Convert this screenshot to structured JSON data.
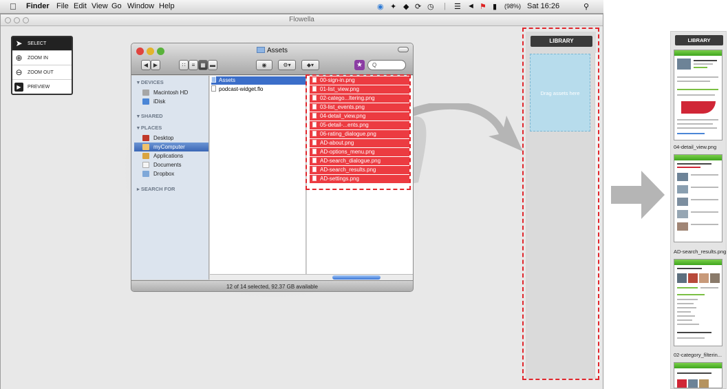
{
  "menubar": {
    "app_name": "Finder",
    "menus": [
      "File",
      "Edit",
      "View",
      "Go",
      "Window",
      "Help"
    ],
    "battery": "(98%)",
    "clock": "Sat 16:26",
    "search_icon": "search-icon"
  },
  "flowella": {
    "title": "Flowella",
    "tools": [
      {
        "label": "SELECT",
        "icon": "arrow-cursor-icon",
        "selected": true
      },
      {
        "label": "ZOOM IN",
        "icon": "zoom-in-icon",
        "selected": false
      },
      {
        "label": "ZOOM OUT",
        "icon": "zoom-out-icon",
        "selected": false
      },
      {
        "label": "PREVIEW",
        "icon": "play-icon",
        "selected": false
      }
    ],
    "library": {
      "header": "LIBRARY",
      "drop_hint": "Drag assets here"
    }
  },
  "finder": {
    "title": "Assets",
    "search_placeholder": "Q",
    "sidebar": {
      "devices_header": "DEVICES",
      "devices": [
        "Macintosh HD",
        "iDisk"
      ],
      "shared_header": "SHARED",
      "places_header": "PLACES",
      "places": [
        {
          "label": "Desktop",
          "selected": false
        },
        {
          "label": "myComputer",
          "selected": true
        },
        {
          "label": "Applications",
          "selected": false
        },
        {
          "label": "Documents",
          "selected": false
        },
        {
          "label": "Dropbox",
          "selected": false
        }
      ],
      "search_header": "SEARCH FOR"
    },
    "column1": [
      "Assets",
      "podcast-widget.flo"
    ],
    "files": [
      "00-sign-in.png",
      "01-list_view.png",
      "02-catego...ltering.png",
      "03-list_events.png",
      "04-detail_view.png",
      "05-detail-...ents.png",
      "06-rating_dialogue.png",
      "AD-about.png",
      "AD-options_menu.png",
      "AD-search_dialogue.png",
      "AD-search_results.png",
      "AD-settings.png"
    ],
    "status": "12 of 14 selected, 92.37 GB available"
  },
  "library_column": {
    "header": "LIBRARY",
    "items": [
      "04-detail_view.png",
      "AD-search_results.png",
      "02-category_filterin..."
    ]
  },
  "colors": {
    "selection_red": "#ec3b41",
    "marquee": "#e0262c",
    "drop_zone": "#b7dcec",
    "arrow_gray": "#b5b5b5",
    "finder_highlight": "#3b6ec9",
    "thumb_green": "#3ea51d"
  }
}
